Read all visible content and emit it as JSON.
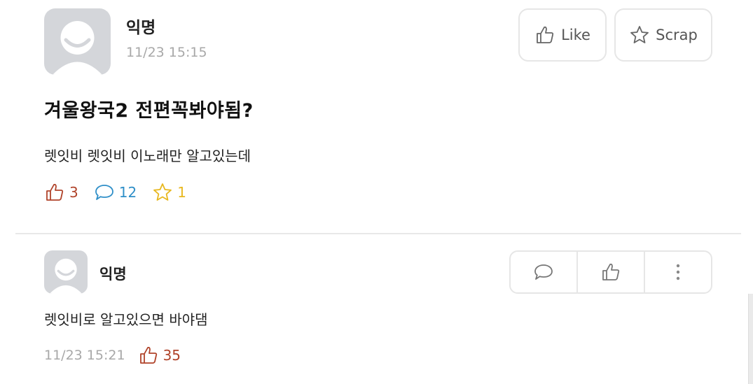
{
  "post": {
    "author": "익명",
    "timestamp": "11/23 15:15",
    "title": "겨울왕국2 전편꼭봐야됨?",
    "body": "렛잇비 렛잇비 이노래만 알고있는데",
    "stats": {
      "likes": "3",
      "comments": "12",
      "scraps": "1"
    },
    "actions": {
      "like_label": "Like",
      "scrap_label": "Scrap"
    }
  },
  "comment": {
    "author": "익명",
    "text": "렛잇비로 알고있으면 바야댐",
    "timestamp": "11/23 15:21",
    "likes": "35"
  },
  "colors": {
    "like_red": "#b0432a",
    "comment_blue": "#2f8fc8",
    "scrap_yellow": "#e8b820",
    "timestamp_gray": "#a8a8a8",
    "avatar_gray": "#d4d6da"
  },
  "icons": [
    "user-avatar-icon",
    "thumbs-up-icon",
    "star-icon",
    "speech-bubble-icon",
    "more-vertical-icon"
  ]
}
